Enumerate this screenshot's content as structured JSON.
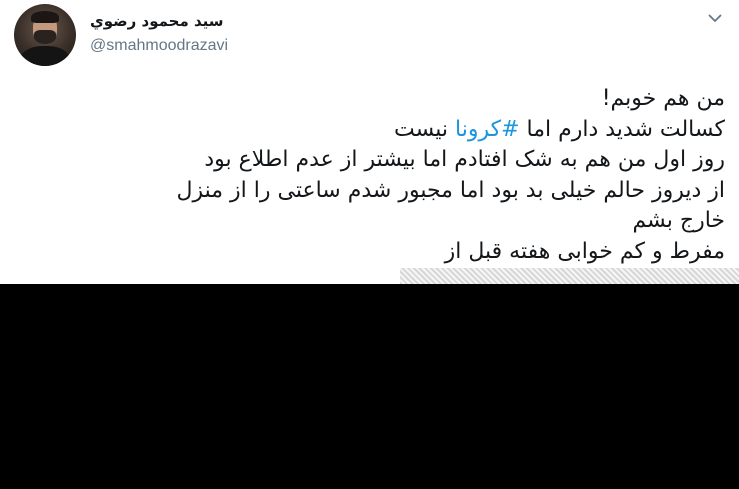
{
  "author": {
    "display_name": "سيد محمود رضوي",
    "username": "@smahmoodrazavi"
  },
  "icons": {
    "avatar": "profile-photo",
    "menu": "chevron-down-icon"
  },
  "colors": {
    "hashtag": "#1b95e0",
    "username": "#657786",
    "text": "#14171a",
    "redaction": "#000000"
  },
  "tweet": {
    "line1": "من هم خوبم!",
    "line2_before": "کسالت شدید دارم اما ",
    "line2_hashtag": "#کرونا",
    "line2_after": " نیست",
    "line3": "روز اول من هم به شک افتادم اما بیشتر از عدم اطلاع بود",
    "line4": "از دیروز حالم خیلی بد بود اما مجبور شدم ساعتی را از منزل",
    "line5": "خارج بشم",
    "line6_partial": "مفرط و کم خوابی هفته قبل از"
  }
}
